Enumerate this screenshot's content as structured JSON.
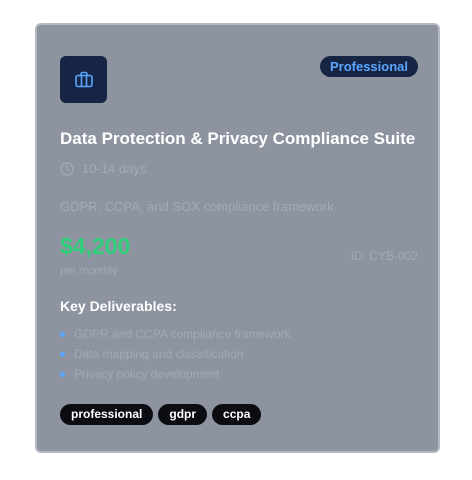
{
  "card": {
    "badge": "Professional",
    "icon": "briefcase-icon",
    "title": "Data Protection & Privacy Compliance Suite",
    "duration": "10-14 days",
    "duration_icon": "clock-icon",
    "description": "GDPR, CCPA, and SOX compliance framework",
    "price": "$4,200",
    "price_period": "per monthly",
    "item_id": "ID: CYB-002",
    "deliverables_heading": "Key Deliverables:",
    "deliverables": [
      "GDPR and CCPA compliance framework",
      "Data mapping and classification",
      "Privacy policy development"
    ],
    "tags": [
      "professional",
      "gdpr",
      "ccpa"
    ]
  },
  "colors": {
    "card_bg": "#8d939f",
    "dark_navy": "#162544",
    "accent_blue": "#5aa6ff",
    "price_green": "#2fd27a",
    "tag_bg": "#0b0d12"
  }
}
